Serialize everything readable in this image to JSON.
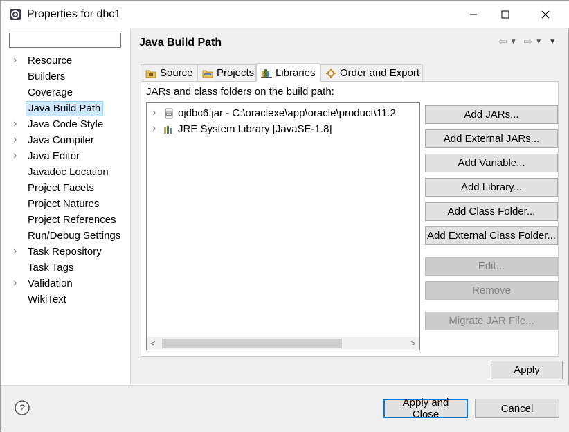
{
  "window": {
    "title": "Properties for dbc1"
  },
  "left_pane": {
    "filter_value": "",
    "tree": [
      {
        "label": "Resource",
        "expandable": true
      },
      {
        "label": "Builders",
        "expandable": false
      },
      {
        "label": "Coverage",
        "expandable": false
      },
      {
        "label": "Java Build Path",
        "expandable": false,
        "selected": true
      },
      {
        "label": "Java Code Style",
        "expandable": true
      },
      {
        "label": "Java Compiler",
        "expandable": true
      },
      {
        "label": "Java Editor",
        "expandable": true
      },
      {
        "label": "Javadoc Location",
        "expandable": false
      },
      {
        "label": "Project Facets",
        "expandable": false
      },
      {
        "label": "Project Natures",
        "expandable": false
      },
      {
        "label": "Project References",
        "expandable": false
      },
      {
        "label": "Run/Debug Settings",
        "expandable": false
      },
      {
        "label": "Task Repository",
        "expandable": true
      },
      {
        "label": "Task Tags",
        "expandable": false
      },
      {
        "label": "Validation",
        "expandable": true
      },
      {
        "label": "WikiText",
        "expandable": false
      }
    ]
  },
  "page": {
    "title": "Java Build Path",
    "tabs": [
      {
        "label": "Source",
        "icon": "source-folder-icon"
      },
      {
        "label": "Projects",
        "icon": "projects-folder-icon"
      },
      {
        "label": "Libraries",
        "icon": "libraries-icon",
        "active": true
      },
      {
        "label": "Order and Export",
        "icon": "order-export-icon"
      }
    ],
    "caption": "JARs and class folders on the build path:",
    "entries": [
      {
        "label": "ojdbc6.jar - C:\\oraclexe\\app\\oracle\\product\\11.2",
        "icon": "jar-icon"
      },
      {
        "label": "JRE System Library [JavaSE-1.8]",
        "icon": "library-icon"
      }
    ],
    "buttons": [
      {
        "label": "Add JARs...",
        "enabled": true
      },
      {
        "label": "Add External JARs...",
        "enabled": true
      },
      {
        "label": "Add Variable...",
        "enabled": true
      },
      {
        "label": "Add Library...",
        "enabled": true
      },
      {
        "label": "Add Class Folder...",
        "enabled": true
      },
      {
        "label": "Add External Class Folder...",
        "enabled": true
      },
      {
        "label": "Edit...",
        "enabled": false
      },
      {
        "label": "Remove",
        "enabled": false
      },
      {
        "label": "Migrate JAR File...",
        "enabled": false
      }
    ],
    "apply_label": "Apply"
  },
  "footer": {
    "help_icon": "help-icon",
    "apply_close_label": "Apply and Close",
    "cancel_label": "Cancel"
  },
  "colors": {
    "selection_bg": "#cce8ff",
    "default_button_border": "#0078d7",
    "dialog_bg": "#f0f0f0"
  }
}
